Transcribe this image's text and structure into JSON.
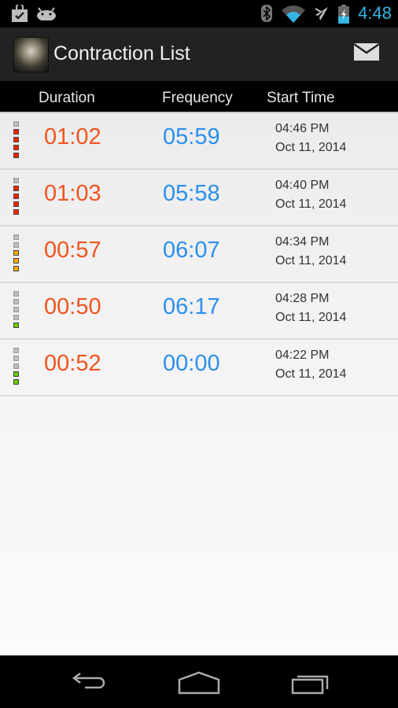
{
  "status_bar": {
    "time": "4:48",
    "icons": [
      "shopping-bag-check-icon",
      "android-icon",
      "bluetooth-icon",
      "wifi-icon",
      "airplane-icon",
      "battery-charging-icon"
    ],
    "accent_color": "#33b5e5"
  },
  "action_bar": {
    "title": "Contraction List",
    "action_icon": "mail-icon"
  },
  "columns": {
    "duration": "Duration",
    "frequency": "Frequency",
    "start_time": "Start Time"
  },
  "colors": {
    "duration": "#f2541f",
    "frequency": "#2a8ff0",
    "level_red": "#ff2200",
    "level_orange": "#ffaa00",
    "level_green": "#66cc00",
    "level_off": "#bdbdbd"
  },
  "contractions": [
    {
      "duration": "01:02",
      "frequency": "05:59",
      "time": "04:46 PM",
      "date": "Oct 11, 2014",
      "intensity": 4,
      "level": "red"
    },
    {
      "duration": "01:03",
      "frequency": "05:58",
      "time": "04:40 PM",
      "date": "Oct 11, 2014",
      "intensity": 4,
      "level": "red"
    },
    {
      "duration": "00:57",
      "frequency": "06:07",
      "time": "04:34 PM",
      "date": "Oct 11, 2014",
      "intensity": 3,
      "level": "orange"
    },
    {
      "duration": "00:50",
      "frequency": "06:17",
      "time": "04:28 PM",
      "date": "Oct 11, 2014",
      "intensity": 1,
      "level": "green"
    },
    {
      "duration": "00:52",
      "frequency": "00:00",
      "time": "04:22 PM",
      "date": "Oct 11, 2014",
      "intensity": 2,
      "level": "green"
    }
  ],
  "intensity_max": 5,
  "nav_bar": {
    "buttons": [
      "back-icon",
      "home-icon",
      "recent-apps-icon"
    ]
  }
}
